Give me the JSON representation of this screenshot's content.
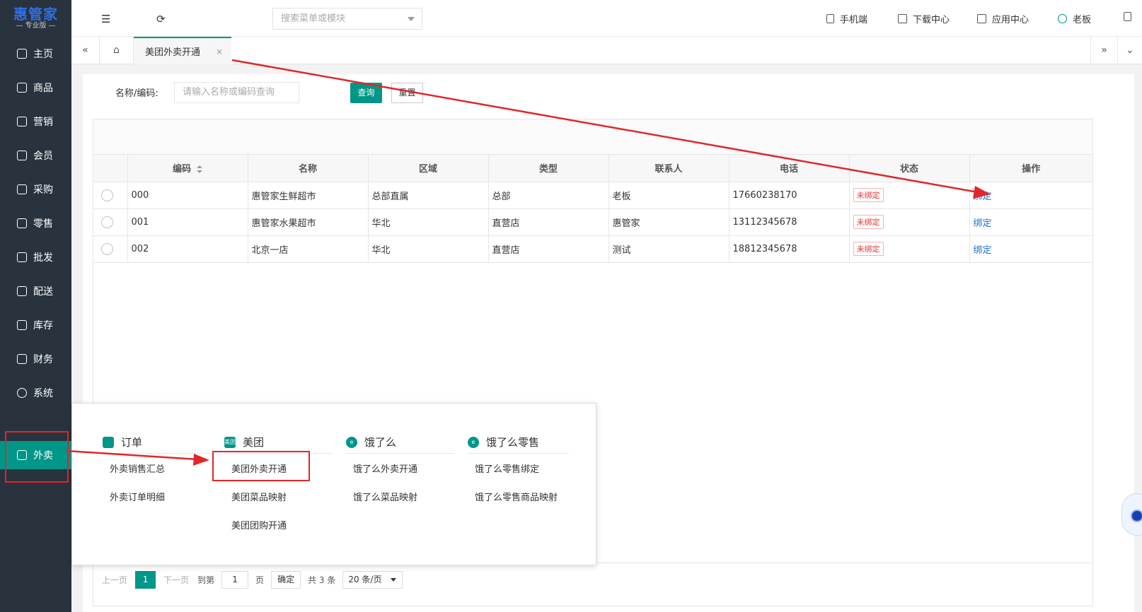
{
  "brand": {
    "name": "惠管家",
    "edition": "— 专业版 —"
  },
  "sidebar": {
    "items": [
      {
        "label": "主页",
        "icon": "home-icon"
      },
      {
        "label": "商品",
        "icon": "cube-icon"
      },
      {
        "label": "营销",
        "icon": "chart-icon"
      },
      {
        "label": "会员",
        "icon": "diamond-icon"
      },
      {
        "label": "采购",
        "icon": "purchase-icon"
      },
      {
        "label": "零售",
        "icon": "bag-icon"
      },
      {
        "label": "批发",
        "icon": "building-icon"
      },
      {
        "label": "配送",
        "icon": "delivery-icon"
      },
      {
        "label": "库存",
        "icon": "inventory-icon"
      },
      {
        "label": "财务",
        "icon": "yen-icon"
      },
      {
        "label": "系统",
        "icon": "settings-icon"
      },
      {
        "label": "外卖",
        "icon": "scooter-icon",
        "active": true
      }
    ]
  },
  "topbar": {
    "menu_search_placeholder": "搜索菜单或模块",
    "mobile": "手机端",
    "download": "下载中心",
    "apps": "应用中心",
    "user": "老板"
  },
  "tabs": {
    "active": "美团外卖开通",
    "close": "×",
    "prev": "«",
    "next": "»"
  },
  "query": {
    "label": "名称/编码:",
    "placeholder": "请输入名称或编码查询",
    "search_btn": "查询",
    "reset_btn": "重置"
  },
  "table": {
    "columns": [
      "编码",
      "名称",
      "区域",
      "类型",
      "联系人",
      "电话",
      "状态",
      "操作"
    ],
    "rows": [
      {
        "code": "000",
        "name": "惠管家生鲜超市",
        "region": "总部直属",
        "type": "总部",
        "contact": "老板",
        "phone": "17660238170",
        "status": "未绑定",
        "action": "绑定"
      },
      {
        "code": "001",
        "name": "惠管家水果超市",
        "region": "华北",
        "type": "直营店",
        "contact": "惠管家",
        "phone": "13112345678",
        "status": "未绑定",
        "action": "绑定"
      },
      {
        "code": "002",
        "name": "北京一店",
        "region": "华北",
        "type": "直营店",
        "contact": "测试",
        "phone": "18812345678",
        "status": "未绑定",
        "action": "绑定"
      }
    ]
  },
  "pager": {
    "prev": "上一页",
    "current": "1",
    "next": "下一页",
    "goto": "到第",
    "page_input": "1",
    "page_unit": "页",
    "confirm": "确定",
    "total": "共 3 条",
    "page_size": "20 条/页"
  },
  "flyout": {
    "groups": [
      {
        "title": "订单",
        "icon": "document-icon",
        "items": [
          "外卖销售汇总",
          "外卖订单明细"
        ]
      },
      {
        "title": "美团",
        "icon": "meituan-icon",
        "icon_text": "美团",
        "items": [
          "美团外卖开通",
          "美团菜品映射",
          "美团团购开通"
        ]
      },
      {
        "title": "饿了么",
        "icon": "eleme-icon",
        "icon_text": "e",
        "items": [
          "饿了么外卖开通",
          "饿了么菜品映射"
        ]
      },
      {
        "title": "饿了么零售",
        "icon": "eleme-icon",
        "icon_text": "e",
        "items": [
          "饿了么零售绑定",
          "饿了么零售商品映射"
        ]
      }
    ]
  },
  "colors": {
    "sidebar": "#28333e",
    "accent": "#009688",
    "annotation": "#e0272b",
    "link": "#1e6fd9"
  }
}
